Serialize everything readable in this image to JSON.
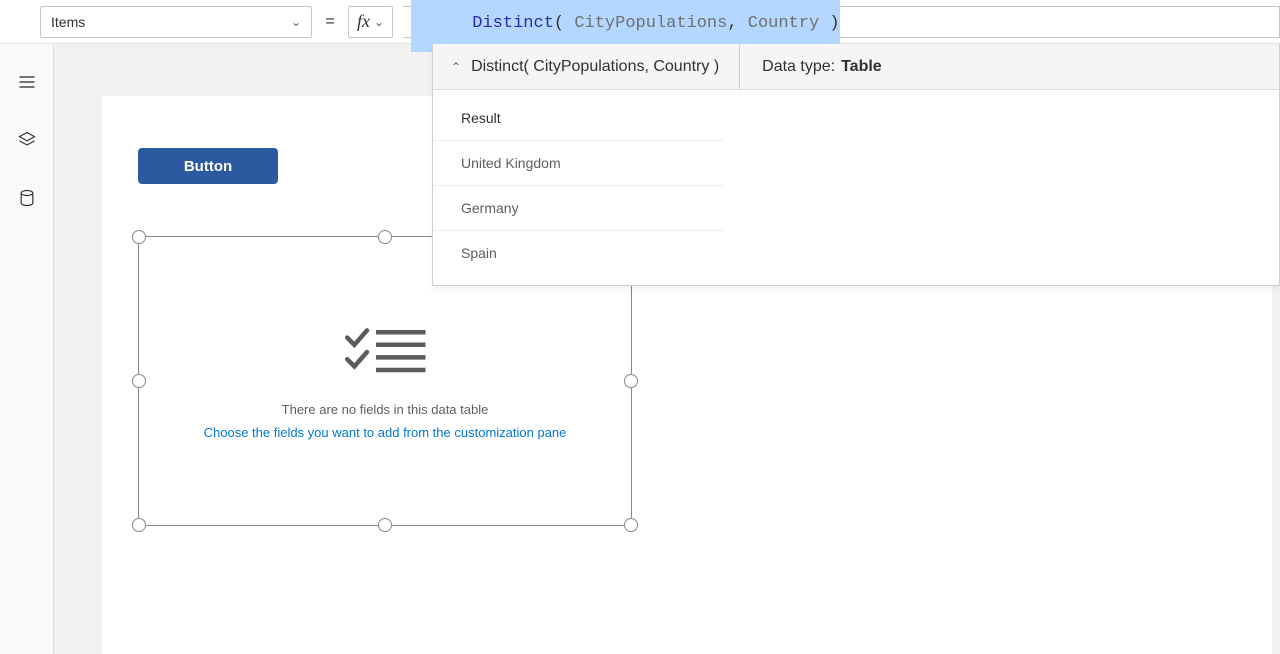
{
  "toolbar": {
    "property": "Items",
    "equals": "=",
    "fx": "fx",
    "formula": {
      "func": "Distinct",
      "open": "(",
      "space1": " ",
      "ds": "CityPopulations",
      "comma": ",",
      "space2": " ",
      "col": "Country",
      "space3": " ",
      "close": ")"
    }
  },
  "intellisense": {
    "expression": "Distinct( CityPopulations, Country )",
    "datatype_label": "Data type:",
    "datatype_value": "Table",
    "columns": [
      "Result"
    ],
    "rows": [
      "United Kingdom",
      "Germany",
      "Spain"
    ]
  },
  "canvas": {
    "button_label": "Button",
    "datatable": {
      "msg1": "There are no fields in this data table",
      "msg2": "Choose the fields you want to add from the customization pane"
    }
  },
  "sidebar": {
    "items": [
      "menu",
      "tree-view",
      "data"
    ]
  }
}
